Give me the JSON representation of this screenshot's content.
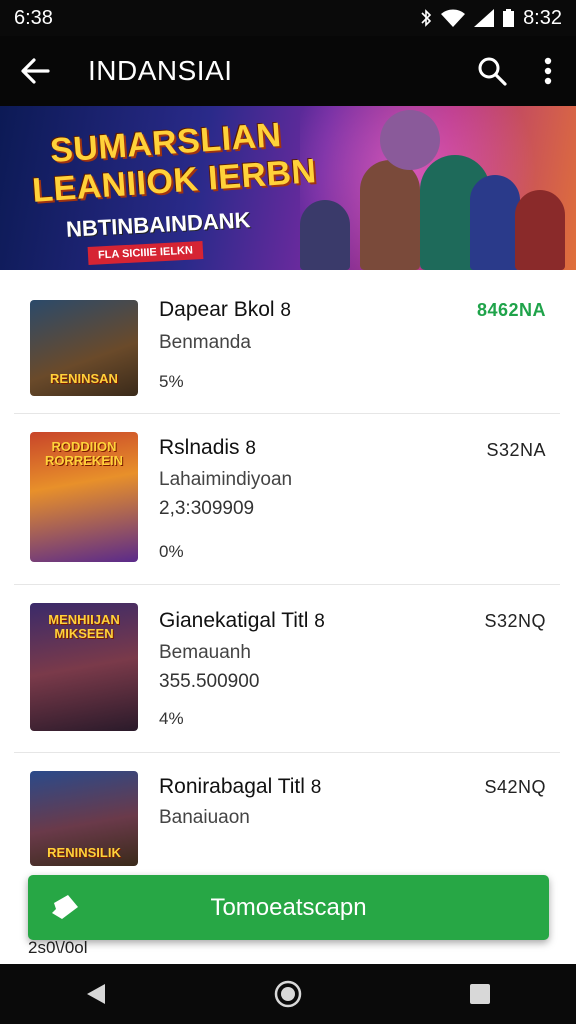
{
  "status_bar": {
    "time": "6:38",
    "clock_right": "8:32"
  },
  "app_bar": {
    "title": "INDANSIAI"
  },
  "banner": {
    "line1": "SUMARSLIAN",
    "line2": "LEANIIOK IERBN",
    "line3": "NBTINBAINDANK",
    "tag": "FLA SICIIIE IELKN"
  },
  "items": [
    {
      "name": "Dapear Bkol",
      "badge": "8",
      "subtitle": "Benmanda",
      "meta": "",
      "rating": "5%",
      "price": "8462NA",
      "price_color": "#1fa34a",
      "thumb_text": "RENINSAN"
    },
    {
      "name": "Rslnadis",
      "badge": "8",
      "subtitle": "Lahaimindiyoan",
      "meta": "2,3:309909",
      "rating": "0%",
      "price": "S32NA",
      "price_color": "#222222",
      "thumb_text": "RODDIION RORREKEIN"
    },
    {
      "name": "Gianekatigal Titl",
      "badge": "8",
      "subtitle": "Bemauanh",
      "meta": "355.500900",
      "rating": "4%",
      "price": "S32NQ",
      "price_color": "#222222",
      "thumb_text": "MENHIIJAN MIKSEEN"
    },
    {
      "name": "Ronirabagal Titl",
      "badge": "8",
      "subtitle": "Banaiuaon",
      "meta": "",
      "rating": "",
      "price": "S42NQ",
      "price_color": "#222222",
      "thumb_text": "RENINSILIK"
    }
  ],
  "cta": {
    "label": "Tomoeatscapn"
  },
  "partial_row": {
    "text": "2s0\\/0ol"
  },
  "icons": {
    "back": "arrow-left-icon",
    "search": "search-icon",
    "more": "more-vert-icon",
    "cta": "ticket-icon",
    "nav_back": "triangle-back-icon",
    "nav_home": "circle-home-icon",
    "nav_recents": "square-recents-icon"
  }
}
